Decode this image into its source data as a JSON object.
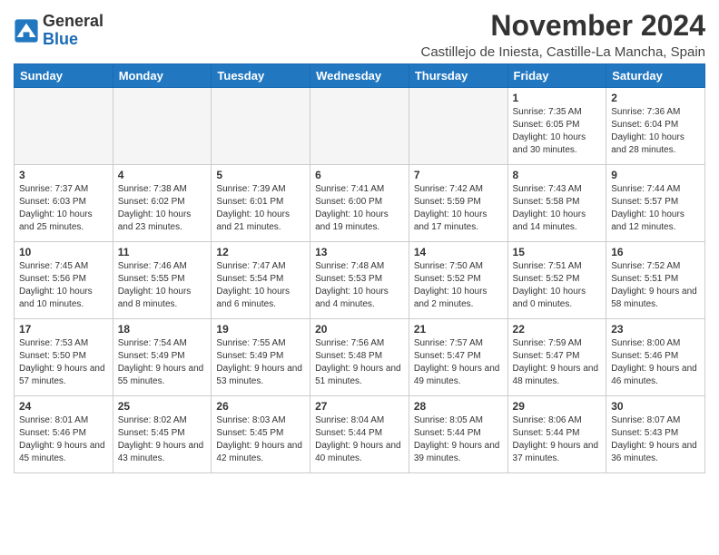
{
  "logo": {
    "general": "General",
    "blue": "Blue"
  },
  "header": {
    "month": "November 2024",
    "location": "Castillejo de Iniesta, Castille-La Mancha, Spain"
  },
  "weekdays": [
    "Sunday",
    "Monday",
    "Tuesday",
    "Wednesday",
    "Thursday",
    "Friday",
    "Saturday"
  ],
  "weeks": [
    [
      {
        "day": "",
        "info": ""
      },
      {
        "day": "",
        "info": ""
      },
      {
        "day": "",
        "info": ""
      },
      {
        "day": "",
        "info": ""
      },
      {
        "day": "",
        "info": ""
      },
      {
        "day": "1",
        "info": "Sunrise: 7:35 AM\nSunset: 6:05 PM\nDaylight: 10 hours and 30 minutes."
      },
      {
        "day": "2",
        "info": "Sunrise: 7:36 AM\nSunset: 6:04 PM\nDaylight: 10 hours and 28 minutes."
      }
    ],
    [
      {
        "day": "3",
        "info": "Sunrise: 7:37 AM\nSunset: 6:03 PM\nDaylight: 10 hours and 25 minutes."
      },
      {
        "day": "4",
        "info": "Sunrise: 7:38 AM\nSunset: 6:02 PM\nDaylight: 10 hours and 23 minutes."
      },
      {
        "day": "5",
        "info": "Sunrise: 7:39 AM\nSunset: 6:01 PM\nDaylight: 10 hours and 21 minutes."
      },
      {
        "day": "6",
        "info": "Sunrise: 7:41 AM\nSunset: 6:00 PM\nDaylight: 10 hours and 19 minutes."
      },
      {
        "day": "7",
        "info": "Sunrise: 7:42 AM\nSunset: 5:59 PM\nDaylight: 10 hours and 17 minutes."
      },
      {
        "day": "8",
        "info": "Sunrise: 7:43 AM\nSunset: 5:58 PM\nDaylight: 10 hours and 14 minutes."
      },
      {
        "day": "9",
        "info": "Sunrise: 7:44 AM\nSunset: 5:57 PM\nDaylight: 10 hours and 12 minutes."
      }
    ],
    [
      {
        "day": "10",
        "info": "Sunrise: 7:45 AM\nSunset: 5:56 PM\nDaylight: 10 hours and 10 minutes."
      },
      {
        "day": "11",
        "info": "Sunrise: 7:46 AM\nSunset: 5:55 PM\nDaylight: 10 hours and 8 minutes."
      },
      {
        "day": "12",
        "info": "Sunrise: 7:47 AM\nSunset: 5:54 PM\nDaylight: 10 hours and 6 minutes."
      },
      {
        "day": "13",
        "info": "Sunrise: 7:48 AM\nSunset: 5:53 PM\nDaylight: 10 hours and 4 minutes."
      },
      {
        "day": "14",
        "info": "Sunrise: 7:50 AM\nSunset: 5:52 PM\nDaylight: 10 hours and 2 minutes."
      },
      {
        "day": "15",
        "info": "Sunrise: 7:51 AM\nSunset: 5:52 PM\nDaylight: 10 hours and 0 minutes."
      },
      {
        "day": "16",
        "info": "Sunrise: 7:52 AM\nSunset: 5:51 PM\nDaylight: 9 hours and 58 minutes."
      }
    ],
    [
      {
        "day": "17",
        "info": "Sunrise: 7:53 AM\nSunset: 5:50 PM\nDaylight: 9 hours and 57 minutes."
      },
      {
        "day": "18",
        "info": "Sunrise: 7:54 AM\nSunset: 5:49 PM\nDaylight: 9 hours and 55 minutes."
      },
      {
        "day": "19",
        "info": "Sunrise: 7:55 AM\nSunset: 5:49 PM\nDaylight: 9 hours and 53 minutes."
      },
      {
        "day": "20",
        "info": "Sunrise: 7:56 AM\nSunset: 5:48 PM\nDaylight: 9 hours and 51 minutes."
      },
      {
        "day": "21",
        "info": "Sunrise: 7:57 AM\nSunset: 5:47 PM\nDaylight: 9 hours and 49 minutes."
      },
      {
        "day": "22",
        "info": "Sunrise: 7:59 AM\nSunset: 5:47 PM\nDaylight: 9 hours and 48 minutes."
      },
      {
        "day": "23",
        "info": "Sunrise: 8:00 AM\nSunset: 5:46 PM\nDaylight: 9 hours and 46 minutes."
      }
    ],
    [
      {
        "day": "24",
        "info": "Sunrise: 8:01 AM\nSunset: 5:46 PM\nDaylight: 9 hours and 45 minutes."
      },
      {
        "day": "25",
        "info": "Sunrise: 8:02 AM\nSunset: 5:45 PM\nDaylight: 9 hours and 43 minutes."
      },
      {
        "day": "26",
        "info": "Sunrise: 8:03 AM\nSunset: 5:45 PM\nDaylight: 9 hours and 42 minutes."
      },
      {
        "day": "27",
        "info": "Sunrise: 8:04 AM\nSunset: 5:44 PM\nDaylight: 9 hours and 40 minutes."
      },
      {
        "day": "28",
        "info": "Sunrise: 8:05 AM\nSunset: 5:44 PM\nDaylight: 9 hours and 39 minutes."
      },
      {
        "day": "29",
        "info": "Sunrise: 8:06 AM\nSunset: 5:44 PM\nDaylight: 9 hours and 37 minutes."
      },
      {
        "day": "30",
        "info": "Sunrise: 8:07 AM\nSunset: 5:43 PM\nDaylight: 9 hours and 36 minutes."
      }
    ]
  ]
}
